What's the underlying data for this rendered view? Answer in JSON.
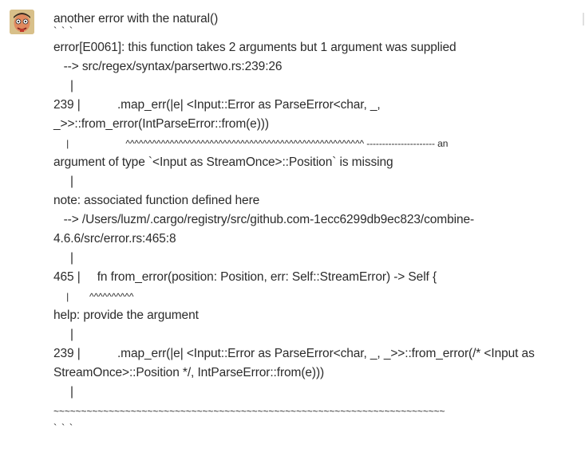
{
  "message": {
    "avatar_icon": "user-avatar-cartoon-face",
    "lines": [
      "another error with the natural()",
      "` ` `",
      "error[E0061]: this function takes 2 arguments but 1 argument was supplied",
      "   --> src/regex/syntax/parsertwo.rs:239:26",
      "     |",
      "239 |           .map_err(|e| <Input::Error as ParseError<char, _,",
      "_>>::from_error(IntParseError::from(e)))",
      "     |                      ^^^^^^^^^^^^^^^^^^^^^^^^^^^^^^^^^^^^^^^^^^^^^^^^^^^^^^ ---------------------- an",
      "argument of type `<Input as StreamOnce>::Position` is missing",
      "     |",
      "note: associated function defined here",
      "   --> /Users/luzm/.cargo/registry/src/github.com-1ecc6299db9ec823/combine-",
      "4.6.6/src/error.rs:465:8",
      "     |",
      "465 |     fn from_error(position: Position, err: Self::StreamError) -> Self {",
      "     |        ^^^^^^^^^^",
      "help: provide the argument",
      "     |",
      "239 |           .map_err(|e| <Input::Error as ParseError<char, _, _>>::from_error(/* <Input as",
      "StreamOnce>::Position */, IntParseError::from(e)))",
      "     |",
      "~~~~~~~~~~~~~~~~~~~~~~~~~~~~~~~~~~~~~~~~~~~~~~~~~~~~~~~~~~~~~~~~~~~~~~~",
      "` ` `"
    ]
  }
}
